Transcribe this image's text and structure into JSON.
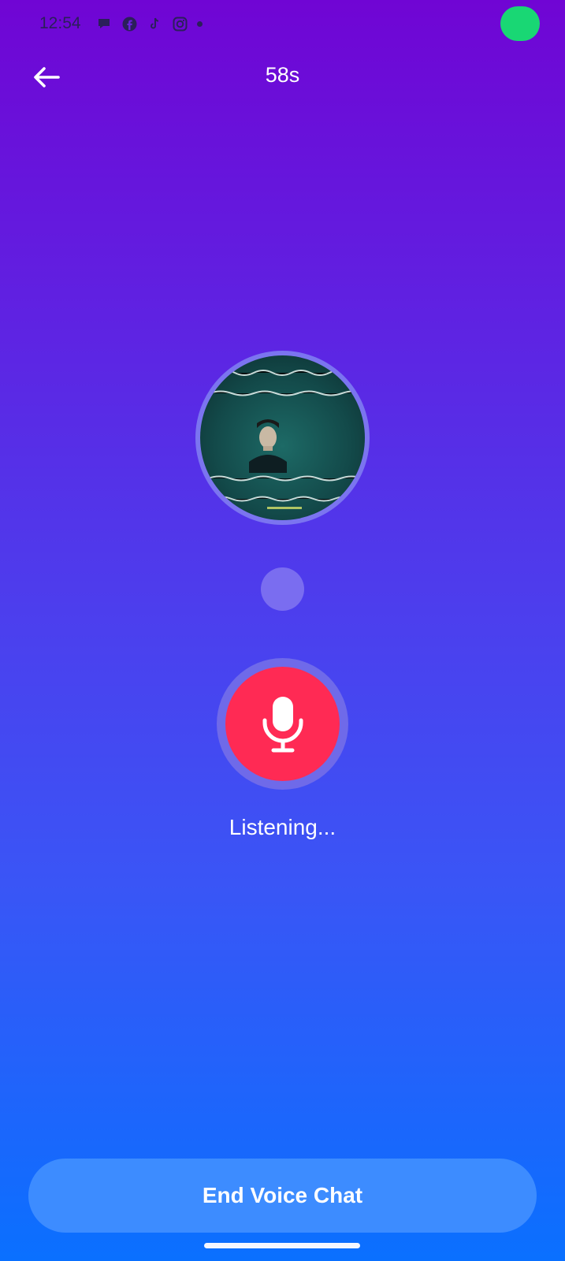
{
  "status_bar": {
    "time": "12:54",
    "icons": [
      "chat-bubble-icon",
      "facebook-icon",
      "tiktok-icon",
      "instagram-icon",
      "notification-dot"
    ],
    "indicator_color": "#19d774"
  },
  "header": {
    "back_icon": "arrow-left-icon",
    "timer": "58s"
  },
  "call": {
    "status": "Listening...",
    "mic_icon": "microphone-icon",
    "mic_color": "#ff2a54"
  },
  "footer": {
    "end_label": "End Voice Chat"
  },
  "colors": {
    "gradient_top": "#7005d4",
    "gradient_bottom": "#0a70ff",
    "button": "#3d8cff"
  }
}
